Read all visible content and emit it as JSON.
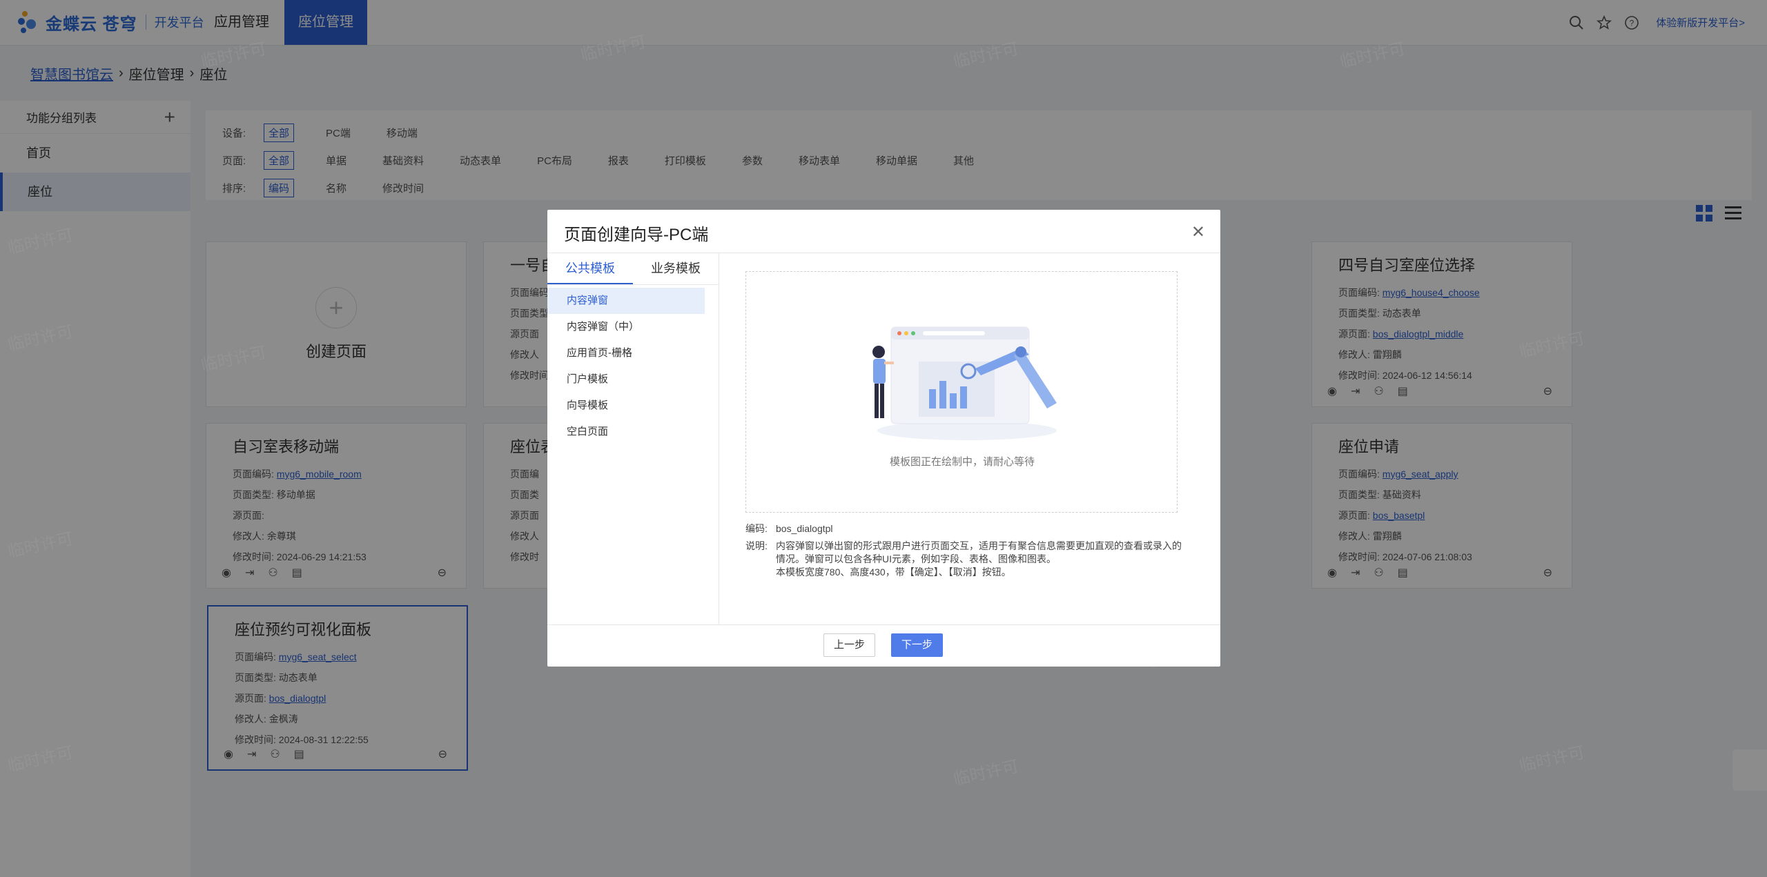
{
  "app": {
    "logo_name": "金蝶云 苍穹",
    "logo_platform": "开发平台",
    "nav": [
      "应用管理",
      "座位管理"
    ],
    "user_link": "体验新版开发平台>"
  },
  "breadcrumb": [
    "智慧图书馆云",
    "座位管理",
    "座位"
  ],
  "sidebar": {
    "header": "功能分组列表",
    "items": [
      "首页",
      "座位"
    ]
  },
  "filters": {
    "device": {
      "label": "设备:",
      "options": [
        "全部",
        "PC端",
        "移动端"
      ]
    },
    "page": {
      "label": "页面:",
      "options": [
        "全部",
        "单据",
        "基础资料",
        "动态表单",
        "PC布局",
        "报表",
        "打印模板",
        "参数",
        "移动表单",
        "移动单据",
        "其他"
      ]
    },
    "sort": {
      "label": "排序:",
      "options": [
        "编码",
        "名称",
        "修改时间"
      ]
    }
  },
  "cards": {
    "create": "创建页面",
    "c_room1": {
      "title": "一号自",
      "code": "页面编码",
      "type": "页面类型",
      "source": "源页面",
      "mod": "修改人",
      "time": "修改时间"
    },
    "c_room4": {
      "title": "四号自习室座位选择",
      "code_label": "页面编码:",
      "code": "myg6_house4_choose",
      "type_label": "页面类型:",
      "type": "动态表单",
      "source_label": "源页面:",
      "source": "bos_dialogtpl_middle",
      "mod_label": "修改人:",
      "mod": "雷翔麟",
      "time_label": "修改时间:",
      "time": "2024-06-12 14:56:14"
    },
    "c_mobile": {
      "title": "自习室表移动端",
      "code_label": "页面编码:",
      "code": "myg6_mobile_room",
      "type_label": "页面类型:",
      "type": "移动单据",
      "source_label": "源页面:",
      "mod_label": "修改人:",
      "mod": "余尊琪",
      "time_label": "修改时间:",
      "time": "2024-06-29 14:21:53"
    },
    "c_seat_tbl": {
      "title": "座位表",
      "code": "页面编",
      "type": "页面类",
      "source": "源页面",
      "mod": "修改人",
      "time": "修改时"
    },
    "c_apply": {
      "title": "座位申请",
      "code_label": "页面编码:",
      "code": "myg6_seat_apply",
      "type_label": "页面类型:",
      "type": "基础资料",
      "source_label": "源页面:",
      "source": "bos_basetpl",
      "mod_label": "修改人:",
      "mod": "雷翔麟",
      "time_label": "修改时间:",
      "time": "2024-07-06 21:08:03"
    },
    "c_visual": {
      "title": "座位预约可视化面板",
      "code_label": "页面编码:",
      "code": "myg6_seat_select",
      "type_label": "页面类型:",
      "type": "动态表单",
      "source_label": "源页面:",
      "source": "bos_dialogtpl",
      "mod_label": "修改人:",
      "mod": "金枫涛",
      "time_label": "修改时间:",
      "time": "2024-08-31 12:22:55"
    }
  },
  "watermark": "临时许可",
  "modal": {
    "title": "页面创建向导-PC端",
    "tabs": [
      "公共模板",
      "业务模板"
    ],
    "templates": [
      "内容弹窗",
      "内容弹窗（中）",
      "应用首页-栅格",
      "门户模板",
      "向导模板",
      "空白页面"
    ],
    "preview_caption": "模板图正在绘制中，请耐心等待",
    "code_label": "编码:",
    "code_value": "bos_dialogtpl",
    "desc_label": "说明:",
    "desc_line1": "内容弹窗以弹出窗的形式跟用户进行页面交互，适用于有聚合信息需要更加直观的查看或录入的情况。弹窗可以包含各种UI元素，例如字段、表格、图像和图表。",
    "desc_line2": "本模板宽度780、高度430，带【确定】、【取消】按钮。",
    "prev": "上一步",
    "next": "下一步"
  },
  "colors": {
    "accent": "#2d5fcf",
    "button_primary": "#4f7ce8",
    "overlay": "rgba(0,0,0,0.45)"
  }
}
